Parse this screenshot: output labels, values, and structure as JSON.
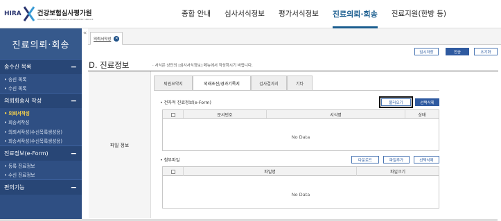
{
  "header": {
    "logo_brand": "HIRA",
    "logo_org": "건강보험심사평가원",
    "logo_sub": "HEALTH INSURANCE REVIEW & ASSESSMENT SERVICE",
    "nav": [
      "종합 안내",
      "심사서식정보",
      "평가서식정보",
      "진료의뢰·회송",
      "진료지원(한방 등)"
    ],
    "active_nav": 3
  },
  "sidebar": {
    "title": "진료의뢰·회송",
    "sections": [
      {
        "label": "송수신 목록",
        "toggle": "−",
        "items": [
          "• 송신 목록",
          "• 수신 목록"
        ]
      },
      {
        "label": "의뢰회송서 작성",
        "toggle": "−",
        "items": [
          "• 의뢰서작성",
          "• 회송서작성",
          "• 의뢰서작성(수신목록생성용)",
          "• 회송서작성(수신목록생성용)"
        ]
      },
      {
        "label": "진료정보(e-Form)",
        "toggle": "−",
        "items": [
          "• 등록 진료정보",
          "• 수신 진료정보"
        ]
      },
      {
        "label": "편의기능",
        "toggle": "−",
        "items": []
      }
    ],
    "active_item": "• 의뢰서작성",
    "collapse_glyph": "«"
  },
  "page_tab": {
    "label": "의뢰서작성",
    "close": "✕"
  },
  "toolbar": {
    "temp_save": "임시저장",
    "send": "전송",
    "reset": "초기화"
  },
  "section": {
    "title": "D. 진료정보",
    "note": "· 서식은 상단의 [심사서식정보] 메뉴에서 작성하시기 바랍니다."
  },
  "row_label": "파일 정보",
  "form_tabs": [
    "퇴원요약지",
    "외래초진/경과기록지",
    "검사결과지",
    "기타"
  ],
  "active_form_tab": 1,
  "eform": {
    "title": "• 전자적 진료정보(e-Form)",
    "import_btn": "불러오기",
    "delete_btn": "선택삭제",
    "columns": [
      "문서번호",
      "서식명",
      "상태"
    ],
    "empty": "No Data"
  },
  "attach": {
    "title": "• 첨부파일",
    "download_btn": "다운로드",
    "add_btn": "파일추가",
    "delete_btn": "선택삭제",
    "columns": [
      "파일명",
      "파일크기"
    ],
    "empty": "No Data"
  }
}
